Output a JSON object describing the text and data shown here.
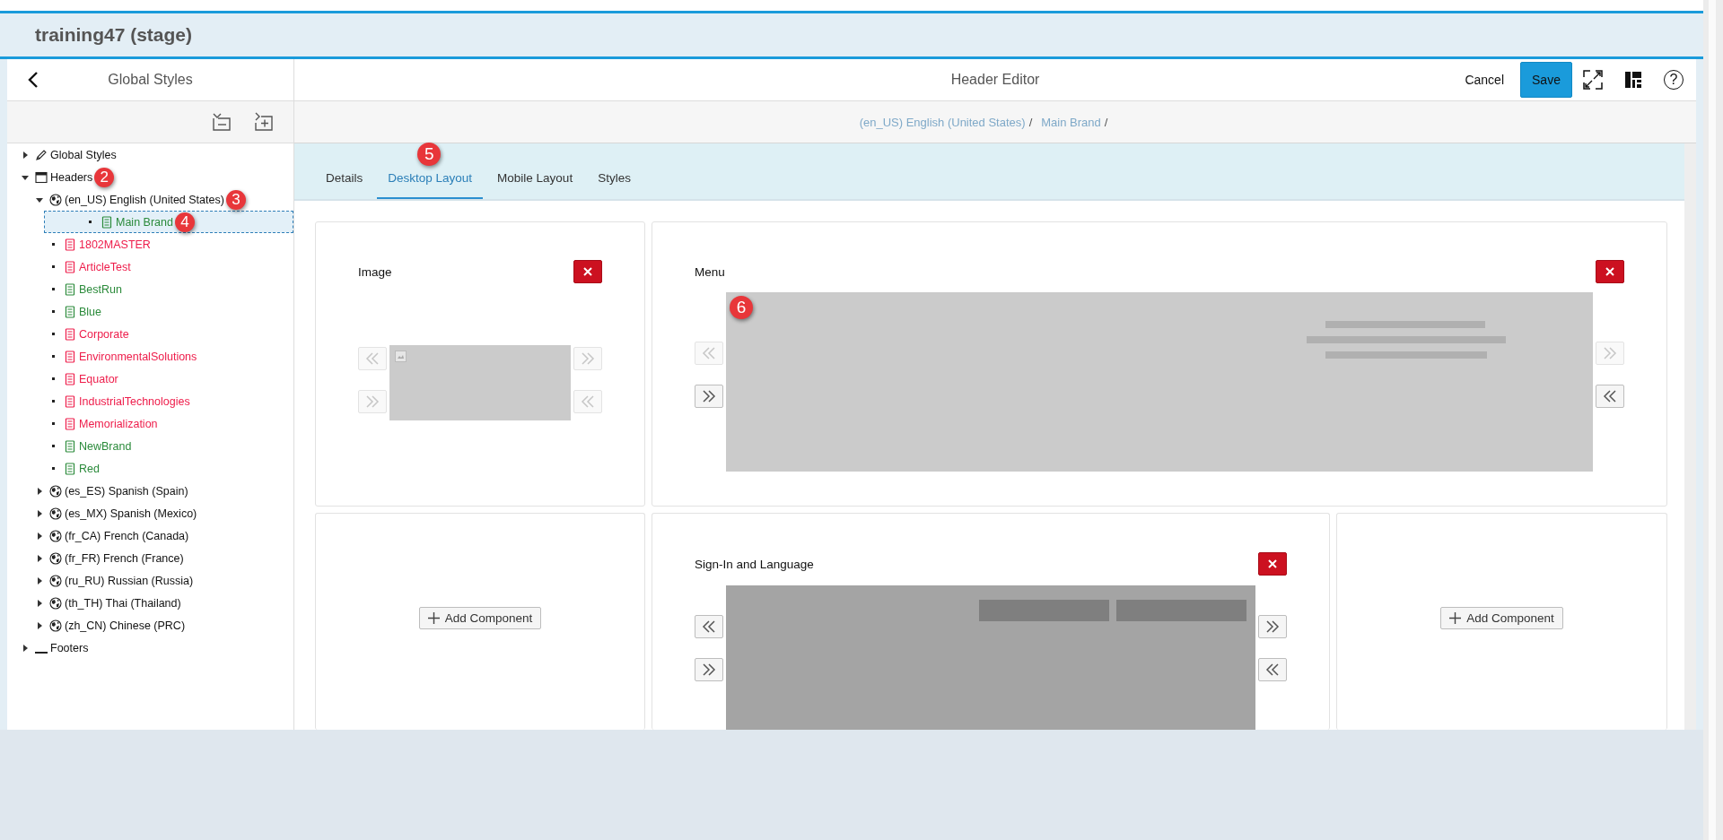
{
  "app_title": "training47 (stage)",
  "sidebar": {
    "title": "Global Styles",
    "toolbar": [
      {
        "kind": "collapse_all"
      },
      {
        "kind": "expand_all"
      }
    ],
    "tree": [
      {
        "label": "Global Styles",
        "kind": "style",
        "expanded": false,
        "selected": false
      },
      {
        "label": "Headers",
        "kind": "header",
        "expanded": true,
        "selected": false,
        "callout": "2",
        "children": [
          {
            "label": "(en_US) English (United States)",
            "kind": "locale",
            "expanded": true,
            "selected": false,
            "callout": "3",
            "children": [
              {
                "label": "Main Brand",
                "kind": "brand",
                "color": "#2a8a3a",
                "selected": true,
                "callout": "4"
              },
              {
                "label": "1802MASTER",
                "kind": "brand",
                "color": "#ee1c4a",
                "selected": false
              },
              {
                "label": "ArticleTest",
                "kind": "brand",
                "color": "#ee1c4a",
                "selected": false
              },
              {
                "label": "BestRun",
                "kind": "brand",
                "color": "#2a8a3a",
                "selected": false
              },
              {
                "label": "Blue",
                "kind": "brand",
                "color": "#2a8a3a",
                "selected": false
              },
              {
                "label": "Corporate",
                "kind": "brand",
                "color": "#ee1c4a",
                "selected": false
              },
              {
                "label": "EnvironmentalSolutions",
                "kind": "brand",
                "color": "#ee1c4a",
                "selected": false
              },
              {
                "label": "Equator",
                "kind": "brand",
                "color": "#ee1c4a",
                "selected": false
              },
              {
                "label": "IndustrialTechnologies",
                "kind": "brand",
                "color": "#ee1c4a",
                "selected": false
              },
              {
                "label": "Memorialization",
                "kind": "brand",
                "color": "#ee1c4a",
                "selected": false
              },
              {
                "label": "NewBrand",
                "kind": "brand",
                "color": "#2a8a3a",
                "selected": false
              },
              {
                "label": "Red",
                "kind": "brand",
                "color": "#2a8a3a",
                "selected": false
              }
            ]
          },
          {
            "label": "(es_ES) Spanish (Spain)",
            "kind": "locale",
            "expanded": false,
            "selected": false
          },
          {
            "label": "(es_MX) Spanish (Mexico)",
            "kind": "locale",
            "expanded": false,
            "selected": false
          },
          {
            "label": "(fr_CA) French (Canada)",
            "kind": "locale",
            "expanded": false,
            "selected": false
          },
          {
            "label": "(fr_FR) French (France)",
            "kind": "locale",
            "expanded": false,
            "selected": false
          },
          {
            "label": "(ru_RU) Russian (Russia)",
            "kind": "locale",
            "expanded": false,
            "selected": false
          },
          {
            "label": "(th_TH) Thai (Thailand)",
            "kind": "locale",
            "expanded": false,
            "selected": false
          },
          {
            "label": "(zh_CN) Chinese (PRC)",
            "kind": "locale",
            "expanded": false,
            "selected": false
          }
        ]
      },
      {
        "label": "Footers",
        "kind": "footer",
        "expanded": false,
        "selected": false
      }
    ]
  },
  "editor": {
    "title": "Header Editor",
    "cancel": "Cancel",
    "save": "Save",
    "actions": [
      {
        "kind": "fullscreen"
      },
      {
        "kind": "layout"
      },
      {
        "kind": "help",
        "glyph": "?"
      }
    ],
    "breadcrumb": [
      {
        "label": "(en_US) English (United States)",
        "separator": "/"
      },
      {
        "label": "Main Brand",
        "separator": "/"
      }
    ],
    "tabs": [
      {
        "label": "Details",
        "selected": false
      },
      {
        "label": "Desktop Layout",
        "selected": true,
        "callout": "5"
      },
      {
        "label": "Mobile Layout",
        "selected": false
      },
      {
        "label": "Styles",
        "selected": false
      }
    ],
    "rows": [
      [
        {
          "kind": "component",
          "title": "Image",
          "preview": {
            "kind": "image"
          },
          "left_buttons": [
            {
              "kind": "left",
              "disabled": true
            },
            {
              "kind": "right",
              "disabled": true
            }
          ],
          "right_buttons": [
            {
              "kind": "right",
              "disabled": true
            },
            {
              "kind": "left",
              "disabled": true
            }
          ]
        },
        {
          "kind": "component",
          "title": "Menu",
          "preview": {
            "kind": "menu"
          },
          "callout": "6",
          "left_buttons": [
            {
              "kind": "left",
              "disabled": true
            },
            {
              "kind": "right",
              "disabled": false
            }
          ],
          "right_buttons": [
            {
              "kind": "right",
              "disabled": true
            },
            {
              "kind": "left",
              "disabled": false
            }
          ]
        }
      ],
      [
        {
          "kind": "empty",
          "add_label": "Add Component"
        },
        {
          "kind": "component",
          "title": "Sign-In and Language",
          "preview": {
            "kind": "signin"
          },
          "left_buttons": [
            {
              "kind": "left",
              "disabled": false
            },
            {
              "kind": "right",
              "disabled": false
            }
          ],
          "right_buttons": [
            {
              "kind": "right",
              "disabled": false
            },
            {
              "kind": "left",
              "disabled": false
            }
          ]
        },
        {
          "kind": "empty",
          "add_label": "Add Component"
        }
      ]
    ]
  }
}
